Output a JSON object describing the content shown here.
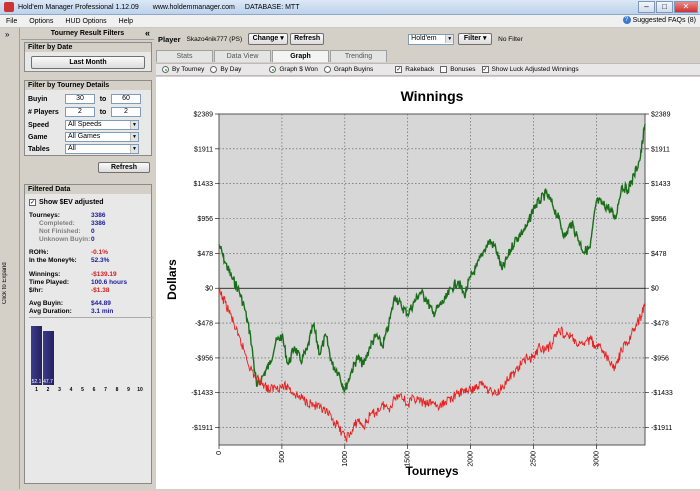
{
  "window": {
    "title": "Hold'em Manager Professional 1.12.09",
    "site": "www.holdemmanager.com",
    "database": "DATABASE: MTT"
  },
  "menu": [
    "File",
    "Options",
    "HUD Options",
    "Help"
  ],
  "faq": "Suggested FAQs (8)",
  "leftstrip": {
    "expand_label": "Click to Expand",
    "arrow": "»"
  },
  "filters": {
    "title": "Tourney Result Filters",
    "by_date": {
      "title": "Filter by Date",
      "button": "Last Month"
    },
    "details": {
      "title": "Filter by Tourney Details",
      "buyin_label": "Buyin",
      "buyin_from": "30",
      "to1": "to",
      "buyin_to": "60",
      "players_label": "# Players",
      "players_from": "2",
      "to2": "to",
      "players_to": "2",
      "speed_label": "Speed",
      "speed_value": "All Speeds",
      "game_label": "Game",
      "game_value": "All Games",
      "tables_label": "Tables",
      "tables_value": "All"
    },
    "refresh": "Refresh"
  },
  "filtered": {
    "title": "Filtered Data",
    "show_ev": "Show $EV adjusted",
    "tourneys_k": "Tourneys:",
    "tourneys_v": "3386",
    "completed_k": "Completed:",
    "completed_v": "3386",
    "notfinished_k": "Not Finished:",
    "notfinished_v": "0",
    "unknown_k": "Unknown Buyin:",
    "unknown_v": "0",
    "roi_k": "ROI%:",
    "roi_v": "-0.1%",
    "itm_k": "In the Money%:",
    "itm_v": "52.3%",
    "winnings_k": "Winnings:",
    "winnings_v": "-$139.19",
    "time_k": "Time Played:",
    "time_v": "100.6 hours",
    "hr_k": "$/hr:",
    "hr_v": "-$1.38",
    "avgbuyin_k": "Avg Buyin:",
    "avgbuyin_v": "$44.89",
    "avgdur_k": "Avg Duration:",
    "avgdur_v": "3.1 min",
    "place_bars": [
      52.1,
      47.7,
      0,
      0,
      0,
      0,
      0,
      0,
      0,
      0
    ],
    "bar_labels": [
      "52.1",
      "47.7"
    ],
    "places": [
      "1",
      "2",
      "3",
      "4",
      "5",
      "6",
      "7",
      "8",
      "9",
      "10"
    ]
  },
  "toolbar": {
    "player_label": "Player",
    "player_value": "Skazo4nik777 (PS)",
    "change": "Change",
    "refresh": "Refresh",
    "game_select": "Hold'em",
    "filter": "Filter",
    "no_filter": "No Filter"
  },
  "tabs": [
    "Stats",
    "Data View",
    "Graph",
    "Trending"
  ],
  "graph_options": {
    "by_tourney": "By Tourney",
    "by_day": "By Day",
    "won": "Graph $ Won",
    "buyins": "Graph Buyins",
    "rakeback": "Rakeback",
    "bonuses": "Bonuses",
    "luck": "Show Luck Adjusted Winnings"
  },
  "colors": {
    "won": "#1a6e1a",
    "luck": "#e82020",
    "plot_bg": "#d7d7d7"
  },
  "chart_data": {
    "type": "line",
    "title": "Winnings",
    "xlabel": "Tourneys",
    "ylabel": "Dollars",
    "xlim": [
      0,
      3386
    ],
    "ylim": [
      -2150,
      2389
    ],
    "yticks": [
      2389,
      1911,
      1433,
      956,
      478,
      0,
      -478,
      -956,
      -1433,
      -1911
    ],
    "ytick_labels": [
      "$2389",
      "$1911",
      "$1433",
      "$956",
      "$478",
      "$0",
      "-$478",
      "-$956",
      "-$1433",
      "-$1911"
    ],
    "xticks": [
      0,
      500,
      1000,
      1500,
      2000,
      2500,
      3000
    ],
    "grid": true,
    "series": [
      {
        "color": "#1a6e1a",
        "x": [
          0,
          50,
          100,
          150,
          200,
          250,
          300,
          350,
          400,
          450,
          500,
          550,
          600,
          650,
          700,
          750,
          800,
          850,
          900,
          950,
          1000,
          1050,
          1100,
          1150,
          1200,
          1250,
          1300,
          1350,
          1400,
          1450,
          1500,
          1550,
          1600,
          1650,
          1700,
          1750,
          1800,
          1850,
          1900,
          1950,
          2000,
          2050,
          2100,
          2150,
          2200,
          2250,
          2300,
          2350,
          2400,
          2450,
          2500,
          2550,
          2600,
          2650,
          2700,
          2750,
          2800,
          2850,
          2900,
          2950,
          3000,
          3050,
          3100,
          3150,
          3200,
          3250,
          3300,
          3350,
          3386
        ],
        "y": [
          600,
          350,
          150,
          0,
          -250,
          -650,
          -1350,
          -1200,
          -1050,
          -750,
          -650,
          -1050,
          -800,
          -1000,
          -850,
          -500,
          -900,
          -650,
          -1050,
          -1150,
          -1400,
          -1150,
          -950,
          -1050,
          -800,
          -650,
          -800,
          -500,
          -100,
          -250,
          -350,
          -200,
          -50,
          -150,
          -350,
          -250,
          -150,
          0,
          100,
          -100,
          150,
          300,
          500,
          650,
          550,
          250,
          450,
          650,
          750,
          850,
          1100,
          1200,
          1300,
          1150,
          950,
          700,
          900,
          700,
          500,
          550,
          1200,
          1150,
          1100,
          950,
          1400,
          1350,
          1550,
          1800,
          2250
        ]
      },
      {
        "color": "#e82020",
        "x": [
          0,
          50,
          100,
          150,
          200,
          250,
          300,
          350,
          400,
          450,
          500,
          550,
          600,
          650,
          700,
          750,
          800,
          850,
          900,
          950,
          1000,
          1050,
          1100,
          1150,
          1200,
          1250,
          1300,
          1350,
          1400,
          1450,
          1500,
          1550,
          1600,
          1650,
          1700,
          1750,
          1800,
          1850,
          1900,
          1950,
          2000,
          2050,
          2100,
          2150,
          2200,
          2250,
          2300,
          2350,
          2400,
          2450,
          2500,
          2550,
          2600,
          2650,
          2700,
          2750,
          2800,
          2850,
          2900,
          2950,
          3000,
          3050,
          3100,
          3150,
          3200,
          3250,
          3300,
          3350,
          3386
        ],
        "y": [
          -50,
          -200,
          -400,
          -650,
          -850,
          -1100,
          -1250,
          -1300,
          -1400,
          -1350,
          -1350,
          -1350,
          -1450,
          -1500,
          -1550,
          -1600,
          -1650,
          -1700,
          -1800,
          -1900,
          -2050,
          -2000,
          -1800,
          -1900,
          -1750,
          -1700,
          -1600,
          -1650,
          -1500,
          -1450,
          -1600,
          -1500,
          -1550,
          -1600,
          -1550,
          -1650,
          -1550,
          -1500,
          -1450,
          -1400,
          -1400,
          -1350,
          -1300,
          -1400,
          -1450,
          -1350,
          -1250,
          -1150,
          -1050,
          -950,
          -950,
          -800,
          -850,
          -750,
          -550,
          -650,
          -650,
          -800,
          -750,
          -700,
          -800,
          -850,
          -1000,
          -1100,
          -850,
          -750,
          -550,
          -400,
          -250
        ]
      }
    ]
  }
}
